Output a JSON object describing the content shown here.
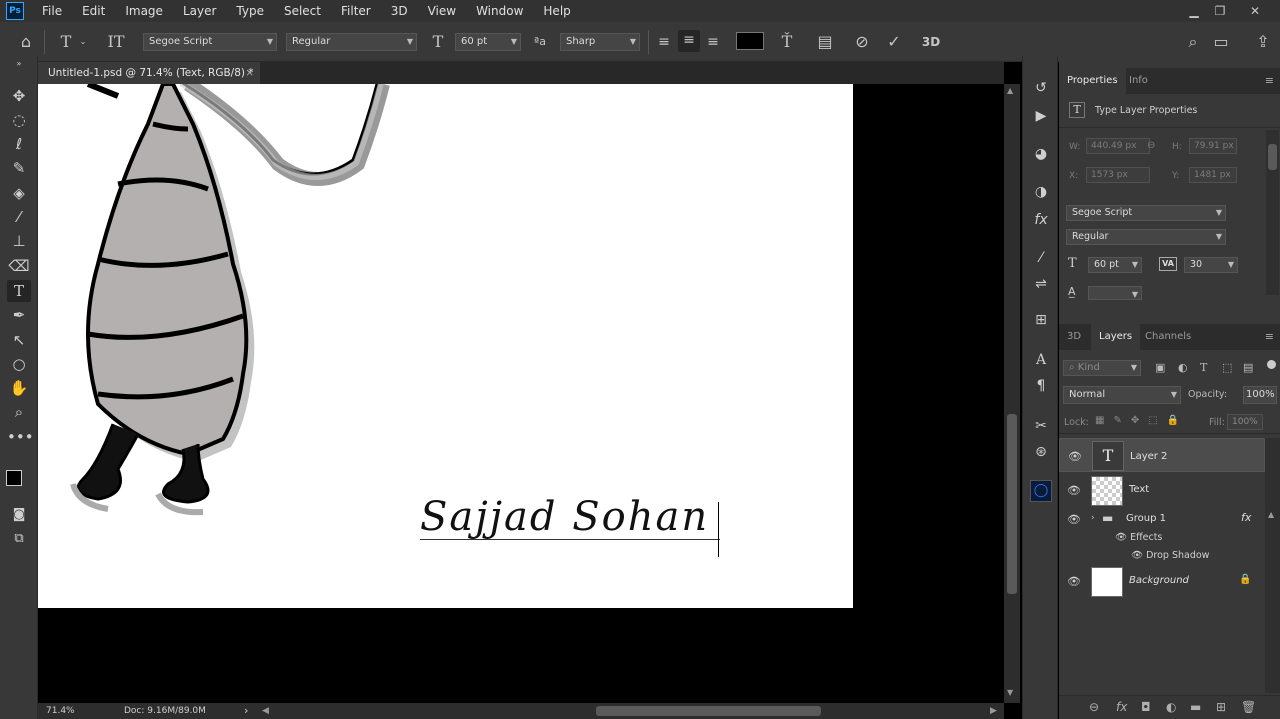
{
  "app": {
    "logo": "Ps",
    "menus": [
      "File",
      "Edit",
      "Image",
      "Layer",
      "Type",
      "Select",
      "Filter",
      "3D",
      "View",
      "Window",
      "Help"
    ]
  },
  "window_controls": {
    "minimize": "▁",
    "restore": "❐",
    "close": "✕"
  },
  "options": {
    "font_family": "Segoe Script",
    "font_style": "Regular",
    "font_size": "60 pt",
    "aa_label": "ªa",
    "antialias": "Sharp",
    "commit_3d": "3D"
  },
  "document": {
    "tab_title": "Untitled-1.psd @ 71.4% (Text, RGB/8) *",
    "close": "×",
    "signature_text": "Sajjad Sohan"
  },
  "status": {
    "zoom": "71.4%",
    "doc": "Doc: 9.16M/89.0M",
    "arrow": "›"
  },
  "properties": {
    "tabs": [
      "Properties",
      "Info"
    ],
    "header": "Type Layer Properties",
    "w_label": "W:",
    "w": "440.49 px",
    "h_label": "H:",
    "h": "79.91 px",
    "x_label": "X:",
    "x": "1573 px",
    "y_label": "Y:",
    "y": "1481 px",
    "font_family": "Segoe Script",
    "font_style": "Regular",
    "font_size": "60 pt",
    "tracking_label": "VA",
    "tracking": "30"
  },
  "layers_panel": {
    "tabs": [
      "3D",
      "Layers",
      "Channels"
    ],
    "kind_placeholder": "Kind",
    "blend_mode": "Normal",
    "opacity_label": "Opacity:",
    "opacity": "100%",
    "lock_label": "Lock:",
    "fill_label": "Fill:",
    "fill": "100%",
    "items": [
      {
        "name": "Layer 2",
        "thumb": "T"
      },
      {
        "name": "Text"
      },
      {
        "name": "Group 1",
        "fx": "fx"
      },
      {
        "name": "Effects"
      },
      {
        "name": "Drop Shadow"
      },
      {
        "name": "Background"
      }
    ]
  },
  "colors": {
    "accent": "#31a8ff",
    "panel": "#383838",
    "canvas": "#ffffff"
  }
}
